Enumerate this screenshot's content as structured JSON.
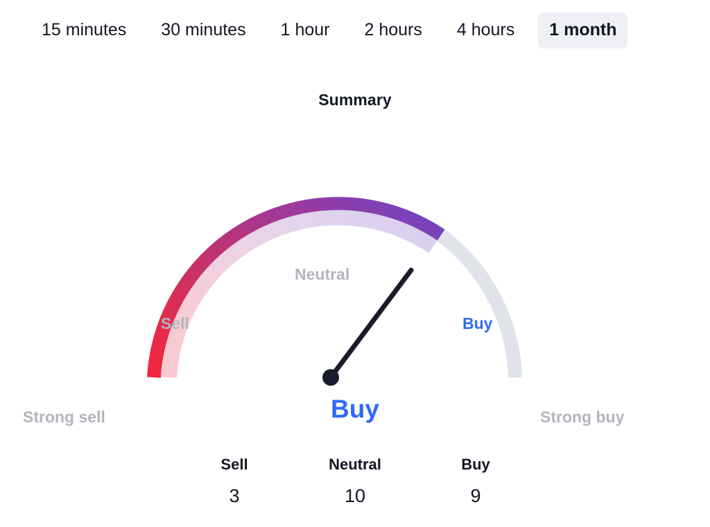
{
  "timeframes": {
    "options": [
      {
        "label": "15 minutes",
        "active": false
      },
      {
        "label": "30 minutes",
        "active": false
      },
      {
        "label": "1 hour",
        "active": false
      },
      {
        "label": "2 hours",
        "active": false
      },
      {
        "label": "4 hours",
        "active": false
      },
      {
        "label": "1 month",
        "active": true
      }
    ],
    "selected": "1 month"
  },
  "summary": {
    "title": "Summary",
    "verdict": "Buy"
  },
  "gauge": {
    "zone_labels": {
      "strong_sell": "Strong sell",
      "sell": "Sell",
      "neutral": "Neutral",
      "buy": "Buy",
      "strong_buy": "Strong buy"
    },
    "needle_angle_deg": 57,
    "filled_fraction": 0.74,
    "colors": {
      "gradient_start": "#f4263e",
      "gradient_mid_1": "#d0305f",
      "gradient_mid_2": "#a8389a",
      "gradient_end": "#6a46c8",
      "track_empty": "#e1e3eb",
      "needle": "#181b2a",
      "accent_blue": "#2f6bf4",
      "label_grey": "#b2b5be",
      "active_tab_bg": "#eef0f6"
    }
  },
  "counts": {
    "columns": [
      {
        "label": "Sell",
        "value": "3"
      },
      {
        "label": "Neutral",
        "value": "10"
      },
      {
        "label": "Buy",
        "value": "9"
      }
    ]
  },
  "chart_data": {
    "type": "gauge",
    "title": "Summary",
    "categories": [
      "Strong sell",
      "Sell",
      "Neutral",
      "Buy",
      "Strong buy"
    ],
    "verdict": "Buy",
    "tallies": {
      "Sell": 3,
      "Neutral": 10,
      "Buy": 9
    },
    "values": [
      3,
      10,
      9
    ],
    "value_labels": [
      "Sell",
      "Neutral",
      "Buy"
    ],
    "needle_position": "Buy",
    "needle_angle_deg": 57,
    "arc_span_deg": 180,
    "filled_fraction": 0.74,
    "legend": "none",
    "grid": false
  }
}
